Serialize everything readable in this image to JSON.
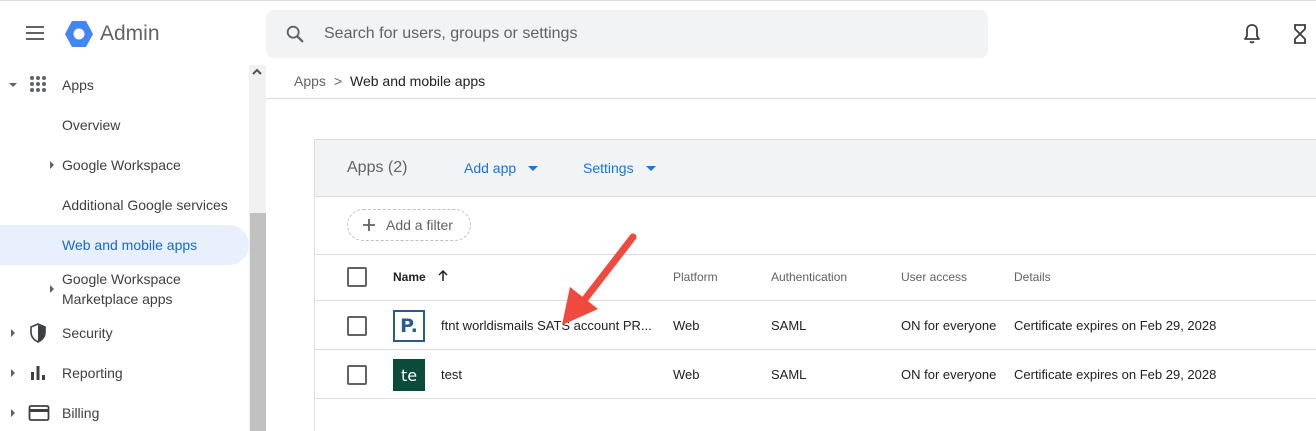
{
  "header": {
    "app_title": "Admin",
    "search_placeholder": "Search for users, groups or settings",
    "brand_color": "#4285f4"
  },
  "sidebar": {
    "items": [
      {
        "label": "Apps",
        "icon": "apps-grid-icon",
        "expanded": true
      },
      {
        "label": "Overview"
      },
      {
        "label": "Google Workspace"
      },
      {
        "label": "Additional Google services"
      },
      {
        "label": "Web and mobile apps",
        "active": true
      },
      {
        "label": "Google Workspace Marketplace apps"
      },
      {
        "label": "Security",
        "icon": "shield-icon"
      },
      {
        "label": "Reporting",
        "icon": "bar-chart-icon"
      },
      {
        "label": "Billing",
        "icon": "credit-card-icon"
      }
    ]
  },
  "breadcrumb": {
    "root": "Apps",
    "separator": ">",
    "current": "Web and mobile apps"
  },
  "card": {
    "title": "Apps (2)",
    "add_app": "Add app",
    "settings": "Settings",
    "filter_label": "Add a filter",
    "columns": [
      "Name",
      "Platform",
      "Authentication",
      "User access",
      "Details"
    ],
    "rows": [
      {
        "logo_text": "P.",
        "name": "ftnt worldismails SATS account PR...",
        "platform": "Web",
        "authentication": "SAML",
        "user_access": "ON for everyone",
        "details": "Certificate expires on Feb 29, 2028"
      },
      {
        "logo_text": "te",
        "name": "test",
        "platform": "Web",
        "authentication": "SAML",
        "user_access": "ON for everyone",
        "details": "Certificate expires on Feb 29, 2028"
      }
    ]
  },
  "annotation": {
    "arrow_color": "#f04a3e"
  }
}
